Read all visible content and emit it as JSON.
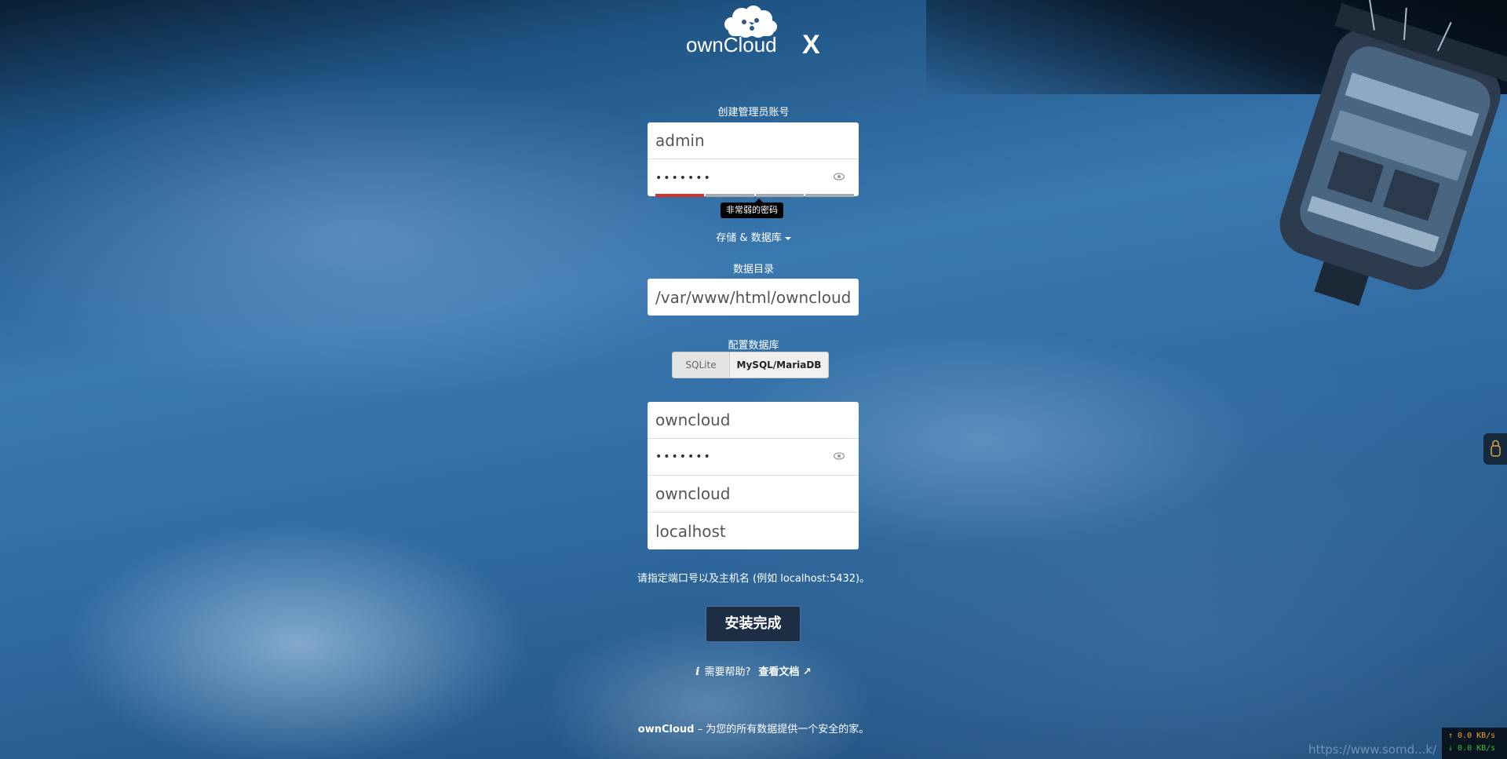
{
  "logo": {
    "text": "ownCloud",
    "suffix": "X"
  },
  "admin": {
    "section_label": "创建管理员账号",
    "username_value": "admin",
    "password_value": "•••••••",
    "strength_tooltip": "非常弱的密码",
    "strength_level": 0.2
  },
  "storage_toggle": {
    "label": "存储 & 数据库"
  },
  "data_dir": {
    "label": "数据目录",
    "value": "/var/www/html/owncloud/data"
  },
  "database": {
    "label": "配置数据库",
    "options": [
      "SQLite",
      "MySQL/MariaDB"
    ],
    "selected": "MySQL/MariaDB",
    "user_value": "owncloud",
    "password_value": "•••••••",
    "name_value": "owncloud",
    "host_value": "localhost",
    "hint": "请指定端口号以及主机名 (例如 localhost:5432)。"
  },
  "submit": {
    "label": "安装完成"
  },
  "help": {
    "text": "需要帮助?",
    "link": "查看文档 ↗",
    "icon": "info-icon"
  },
  "footer": {
    "brand": "ownCloud",
    "text": " – 为您的所有数据提供一个安全的家。"
  },
  "netspeed": {
    "up": "↑ 0.0 KB/s",
    "down": "↓ 0.0 KB/s"
  },
  "watermark": "https://www.somd...k/",
  "colors": {
    "submit_bg": "#1d2d44",
    "strength_bar": "#d2322d"
  }
}
